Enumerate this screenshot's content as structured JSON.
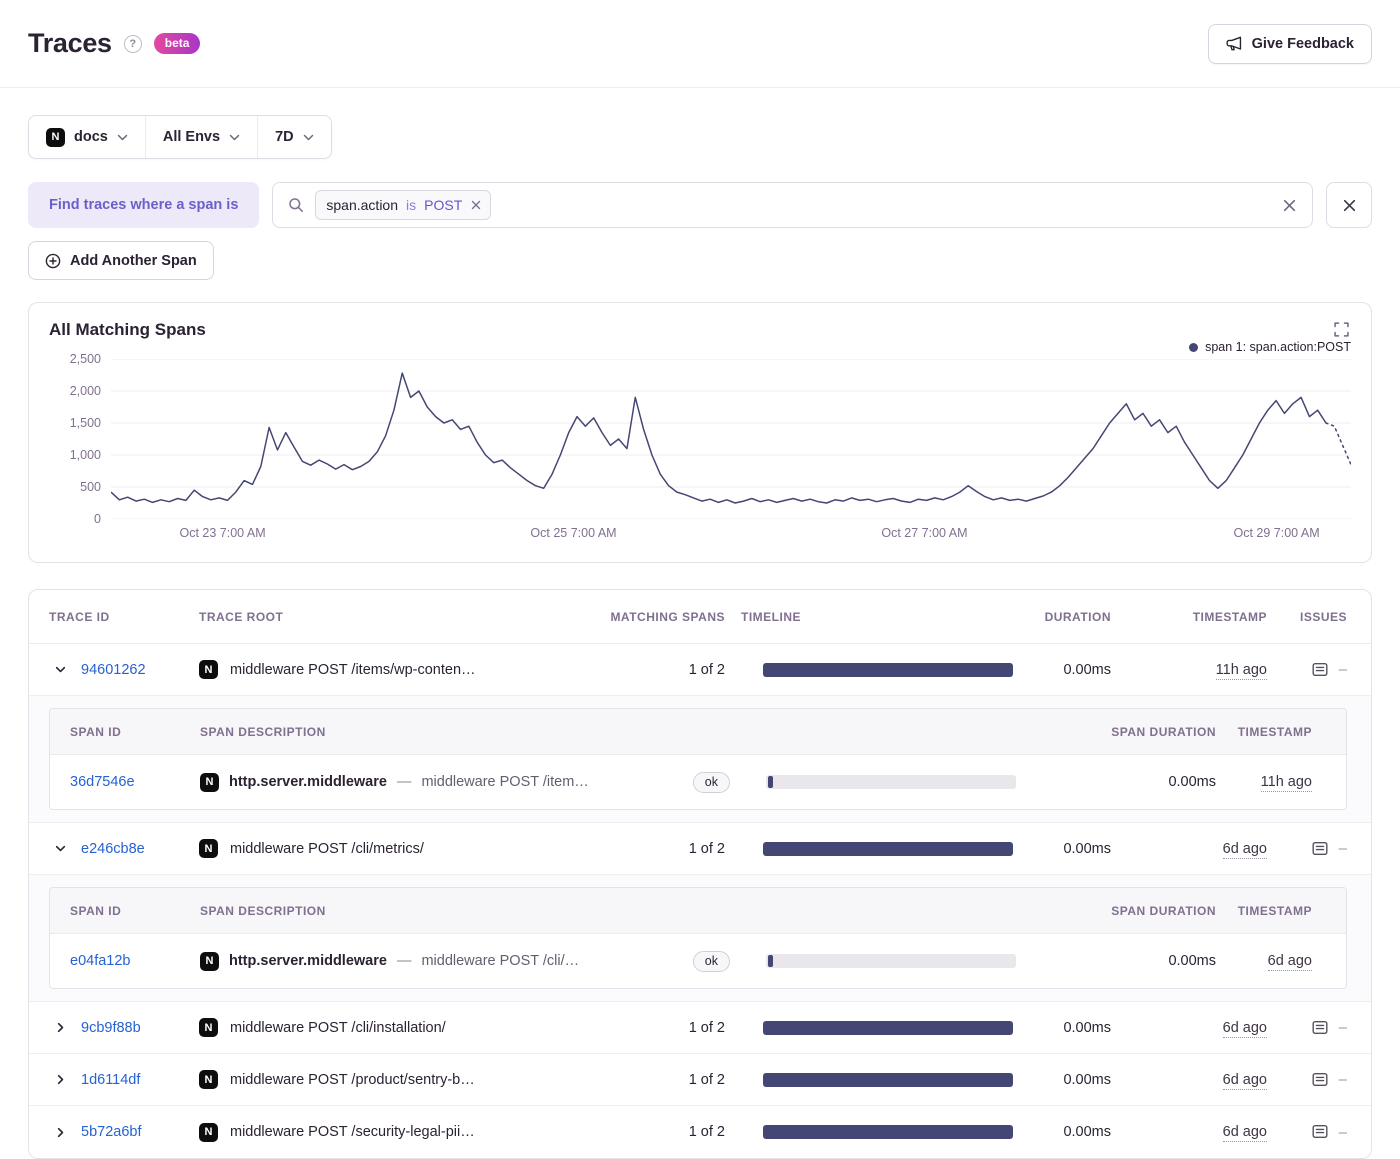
{
  "colors": {
    "accent": "#6C5FC7",
    "accent_bg": "#EDE9F9",
    "link": "#2562D4",
    "chart_line": "#444674",
    "timeline_bar": "#444674",
    "beta_from": "#E349A0",
    "beta_to": "#A737C6"
  },
  "header": {
    "title": "Traces",
    "help_glyph": "?",
    "beta_label": "beta",
    "feedback_label": "Give Feedback"
  },
  "filters": {
    "project": {
      "label": "docs",
      "platform_letter": "N"
    },
    "environment": {
      "label": "All Envs"
    },
    "date_range": {
      "label": "7D"
    }
  },
  "span_search": {
    "prefix_label": "Find traces where a span is",
    "token": {
      "key": "span.action",
      "operator": "is",
      "value": "POST"
    },
    "add_button_label": "Add Another Span"
  },
  "chart_panel": {
    "title": "All Matching Spans",
    "legend": {
      "series_label": "span 1: span.action:POST"
    }
  },
  "chart_data": {
    "type": "line",
    "title": "All Matching Spans",
    "ylim": [
      0,
      2500
    ],
    "y_ticks": [
      0,
      500,
      1000,
      1500,
      2000,
      2500
    ],
    "y_tick_labels": [
      "0",
      "500",
      "1,000",
      "1,500",
      "2,000",
      "2,500"
    ],
    "x_ticks": [
      {
        "label": "Oct 23 7:00 AM",
        "pos": 0.09
      },
      {
        "label": "Oct 25 7:00 AM",
        "pos": 0.373
      },
      {
        "label": "Oct 27 7:00 AM",
        "pos": 0.656
      },
      {
        "label": "Oct 29 7:00 AM",
        "pos": 0.94
      }
    ],
    "grid": true,
    "legend_position": "top-right",
    "series": [
      {
        "name": "span 1: span.action:POST",
        "values": [
          420,
          300,
          340,
          280,
          310,
          260,
          300,
          270,
          320,
          290,
          450,
          350,
          300,
          330,
          290,
          420,
          600,
          540,
          820,
          1430,
          1080,
          1350,
          1120,
          900,
          840,
          920,
          860,
          780,
          850,
          770,
          820,
          900,
          1050,
          1300,
          1700,
          2280,
          1900,
          2000,
          1750,
          1600,
          1500,
          1550,
          1400,
          1450,
          1200,
          1000,
          880,
          920,
          800,
          700,
          600,
          520,
          480,
          700,
          1000,
          1350,
          1600,
          1450,
          1580,
          1350,
          1150,
          1250,
          1100,
          1900,
          1400,
          1000,
          700,
          520,
          420,
          380,
          330,
          280,
          310,
          260,
          300,
          250,
          280,
          320,
          270,
          300,
          260,
          290,
          320,
          280,
          310,
          270,
          250,
          300,
          280,
          330,
          290,
          310,
          270,
          300,
          320,
          280,
          260,
          310,
          290,
          330,
          300,
          350,
          420,
          520,
          430,
          350,
          300,
          330,
          290,
          310,
          280,
          320,
          360,
          420,
          520,
          650,
          800,
          950,
          1100,
          1300,
          1500,
          1650,
          1800,
          1550,
          1650,
          1450,
          1550,
          1350,
          1450,
          1200,
          1000,
          800,
          600,
          480,
          600,
          800,
          1000,
          1250,
          1500,
          1700,
          1850,
          1650,
          1800,
          1900,
          1600,
          1700,
          1500,
          1450,
          1150,
          850
        ]
      }
    ]
  },
  "trace_table": {
    "columns": [
      "Trace ID",
      "Trace Root",
      "Matching Spans",
      "Timeline",
      "Duration",
      "Timestamp",
      "Issues"
    ],
    "span_columns": [
      "Span ID",
      "Span Description",
      "Span Duration",
      "Timestamp"
    ],
    "platform_letter": "N",
    "issues_placeholder": "–",
    "rows": [
      {
        "id": "94601262",
        "expanded": true,
        "root": "middleware POST /items/wp-conten…",
        "matching": "1 of 2",
        "duration": "0.00ms",
        "timestamp": "11h ago",
        "spans": [
          {
            "id": "36d7546e",
            "op": "http.server.middleware",
            "desc": "middleware POST /item…",
            "status": "ok",
            "duration": "0.00ms",
            "timestamp": "11h ago"
          }
        ]
      },
      {
        "id": "e246cb8e",
        "expanded": true,
        "root": "middleware POST /cli/metrics/",
        "matching": "1 of 2",
        "duration": "0.00ms",
        "timestamp": "6d ago",
        "spans": [
          {
            "id": "e04fa12b",
            "op": "http.server.middleware",
            "desc": "middleware POST /cli/…",
            "status": "ok",
            "duration": "0.00ms",
            "timestamp": "6d ago"
          }
        ]
      },
      {
        "id": "9cb9f88b",
        "expanded": false,
        "root": "middleware POST /cli/installation/",
        "matching": "1 of 2",
        "duration": "0.00ms",
        "timestamp": "6d ago"
      },
      {
        "id": "1d6114df",
        "expanded": false,
        "root": "middleware POST /product/sentry-b…",
        "matching": "1 of 2",
        "duration": "0.00ms",
        "timestamp": "6d ago"
      },
      {
        "id": "5b72a6bf",
        "expanded": false,
        "root": "middleware POST /security-legal-pii…",
        "matching": "1 of 2",
        "duration": "0.00ms",
        "timestamp": "6d ago"
      }
    ]
  }
}
